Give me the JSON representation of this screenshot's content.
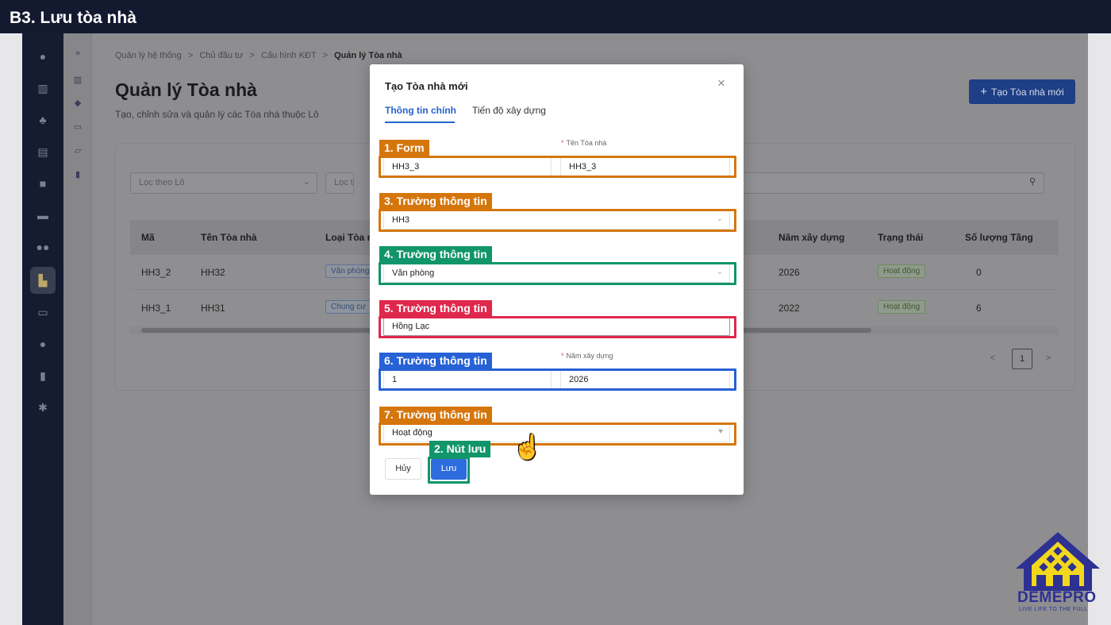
{
  "slide_title": "B3. Lưu tòa nhà",
  "nav_icons": [
    "user-icon",
    "building-icon",
    "org-icon",
    "calculator-icon",
    "briefcase-icon",
    "car-icon",
    "users-icon",
    "apartment-icon",
    "store-icon",
    "person-icon",
    "chart-icon",
    "settings-icon"
  ],
  "sub_icons": [
    "expand-icon",
    "bank-icon",
    "tag-icon",
    "shop-icon",
    "inbox-icon",
    "bus-icon"
  ],
  "breadcrumb": {
    "items": [
      "Quản lý hệ thống",
      "Chủ đầu tư",
      "Cấu hình KĐT"
    ],
    "current": "Quản lý Tòa nhà",
    "sep": ">"
  },
  "page": {
    "title": "Quản lý Tòa nhà",
    "subtitle": "Tạo, chỉnh sửa và quản lý các Tòa nhà thuộc Lô",
    "add_button": "Tạo Tòa nhà mới",
    "add_icon": "+"
  },
  "filters": {
    "lot": "Lọc theo Lô",
    "second": "Lọc t"
  },
  "table": {
    "headers": [
      "Mã",
      "Tên Tòa nhà",
      "Loại Tòa n",
      "Năm xây dựng",
      "Trạng thái",
      "Số lượng Tầng"
    ],
    "rows": [
      {
        "code": "HH3_2",
        "name": "HH32",
        "type": "Văn phòng",
        "year": "2026",
        "status": "Hoạt động",
        "floors": "0"
      },
      {
        "code": "HH3_1",
        "name": "HH31",
        "type": "Chung cư",
        "year": "2022",
        "status": "Hoạt động",
        "floors": "6"
      }
    ]
  },
  "pager": {
    "prev": "<",
    "page": "1",
    "next": ">"
  },
  "modal": {
    "title": "Tạo Tòa nhà mới",
    "close": "×",
    "tabs": [
      "Thông tin chính",
      "Tiến độ xây dựng"
    ],
    "fields": {
      "code": "HH3_3",
      "name_label": "Tên Tòa nhà",
      "name": "HH3_3",
      "lot": "HH3",
      "type": "Văn phòng",
      "address": "Hồng Lạc",
      "floors": "1",
      "year_label": "Năm xây dựng",
      "year": "2026",
      "status": "Hoạt động",
      "required_mark": "*"
    },
    "cancel": "Hủy",
    "save": "Lưu"
  },
  "annotations": {
    "a1": "1. Form",
    "a2": "2. Nút lưu",
    "a3": "3. Trường thông tin",
    "a4": "4. Trường thông tin",
    "a5": "5. Trường thông tin",
    "a6": "6. Trường thông tin",
    "a7": "7. Trường thông tin"
  },
  "colors": {
    "orange": "#d5760c",
    "green": "#11956a",
    "red": "#e0274c",
    "blue": "#2661d6",
    "primary": "#2d6cdf"
  },
  "logo": {
    "brand": "DEMEPRO",
    "slogan": "LIVE LIFE TO THE FULL"
  }
}
